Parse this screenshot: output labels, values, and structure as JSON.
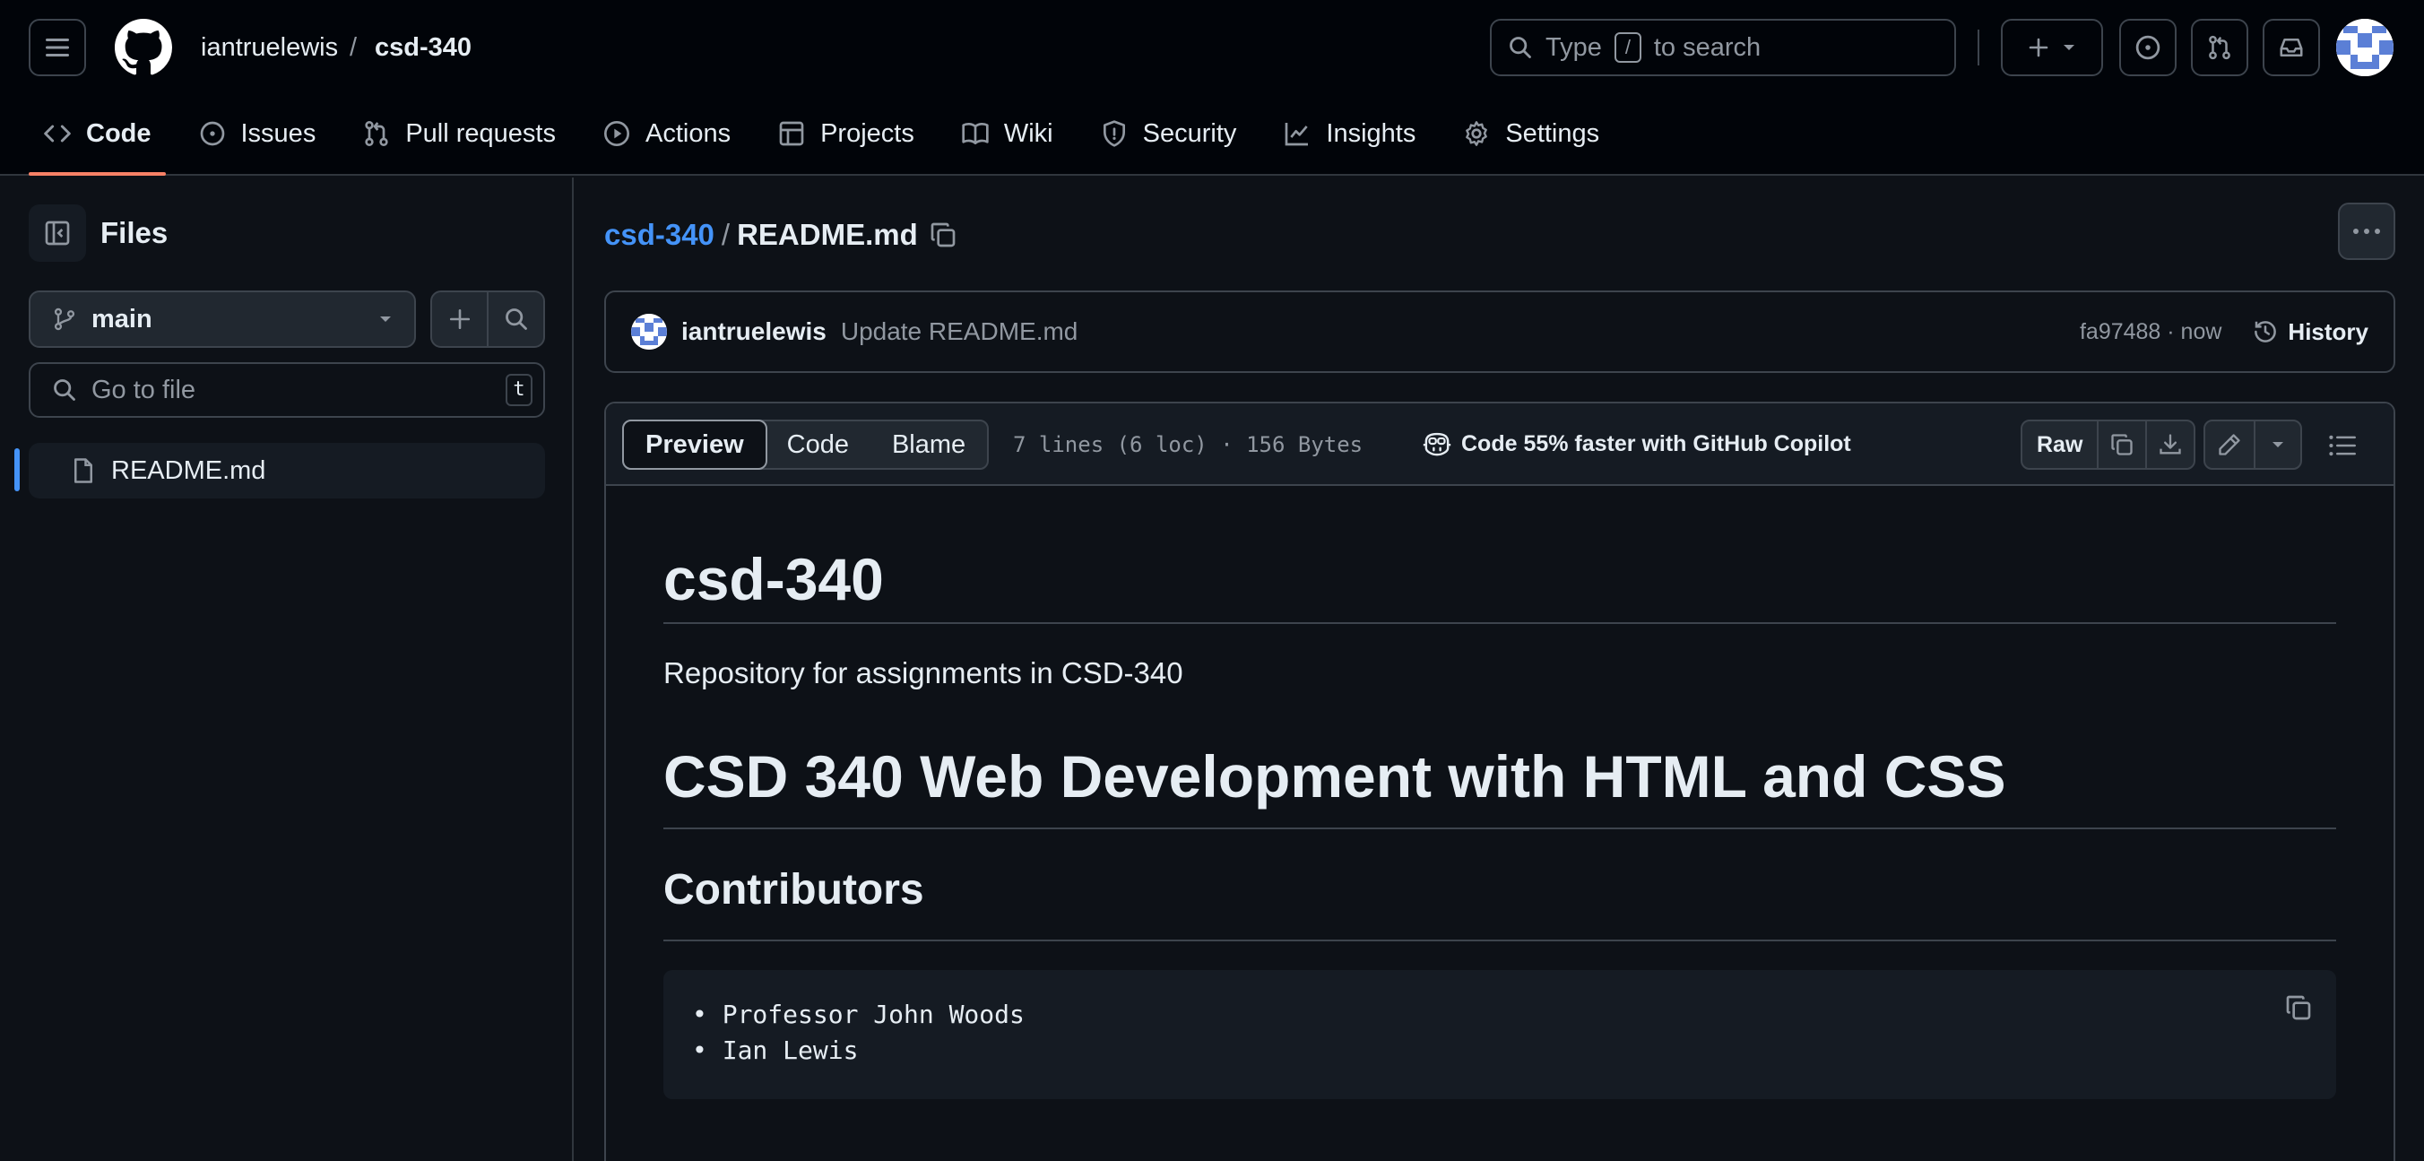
{
  "header": {
    "owner": "iantruelewis",
    "separator": "/",
    "repo": "csd-340",
    "search_prefix": "Type",
    "search_key": "/",
    "search_suffix": "to search"
  },
  "nav": {
    "tabs": [
      {
        "label": "Code",
        "icon": "code-icon",
        "active": true
      },
      {
        "label": "Issues",
        "icon": "issue-icon"
      },
      {
        "label": "Pull requests",
        "icon": "pull-request-icon"
      },
      {
        "label": "Actions",
        "icon": "play-icon"
      },
      {
        "label": "Projects",
        "icon": "table-icon"
      },
      {
        "label": "Wiki",
        "icon": "book-icon"
      },
      {
        "label": "Security",
        "icon": "shield-icon"
      },
      {
        "label": "Insights",
        "icon": "graph-icon"
      },
      {
        "label": "Settings",
        "icon": "gear-icon"
      }
    ]
  },
  "sidebar": {
    "title": "Files",
    "branch": "main",
    "goto_placeholder": "Go to file",
    "goto_shortcut": "t",
    "files": [
      {
        "name": "README.md",
        "selected": true
      }
    ]
  },
  "breadcrumb": {
    "repo": "csd-340",
    "separator": "/",
    "file": "README.md"
  },
  "commit": {
    "author": "iantruelewis",
    "message": "Update README.md",
    "meta": "fa97488 · now",
    "history_label": "History"
  },
  "file_view": {
    "tabs": [
      "Preview",
      "Code",
      "Blame"
    ],
    "active_tab": "Preview",
    "info": "7 lines (6 loc) · 156 Bytes",
    "copilot_text": "Code 55% faster with GitHub Copilot",
    "raw_label": "Raw"
  },
  "readme": {
    "title": "csd-340",
    "description": "Repository for assignments in CSD-340",
    "heading": "CSD 340 Web Development with HTML and CSS",
    "subheading": "Contributors",
    "contributors": [
      "• Professor John Woods",
      "• Ian Lewis"
    ]
  },
  "colors": {
    "background": "#0d1117",
    "header_bg": "#010409",
    "link": "#4493f8",
    "active_tab_underline": "#f78166",
    "border": "#3d444d",
    "muted_text": "#9198a1"
  }
}
